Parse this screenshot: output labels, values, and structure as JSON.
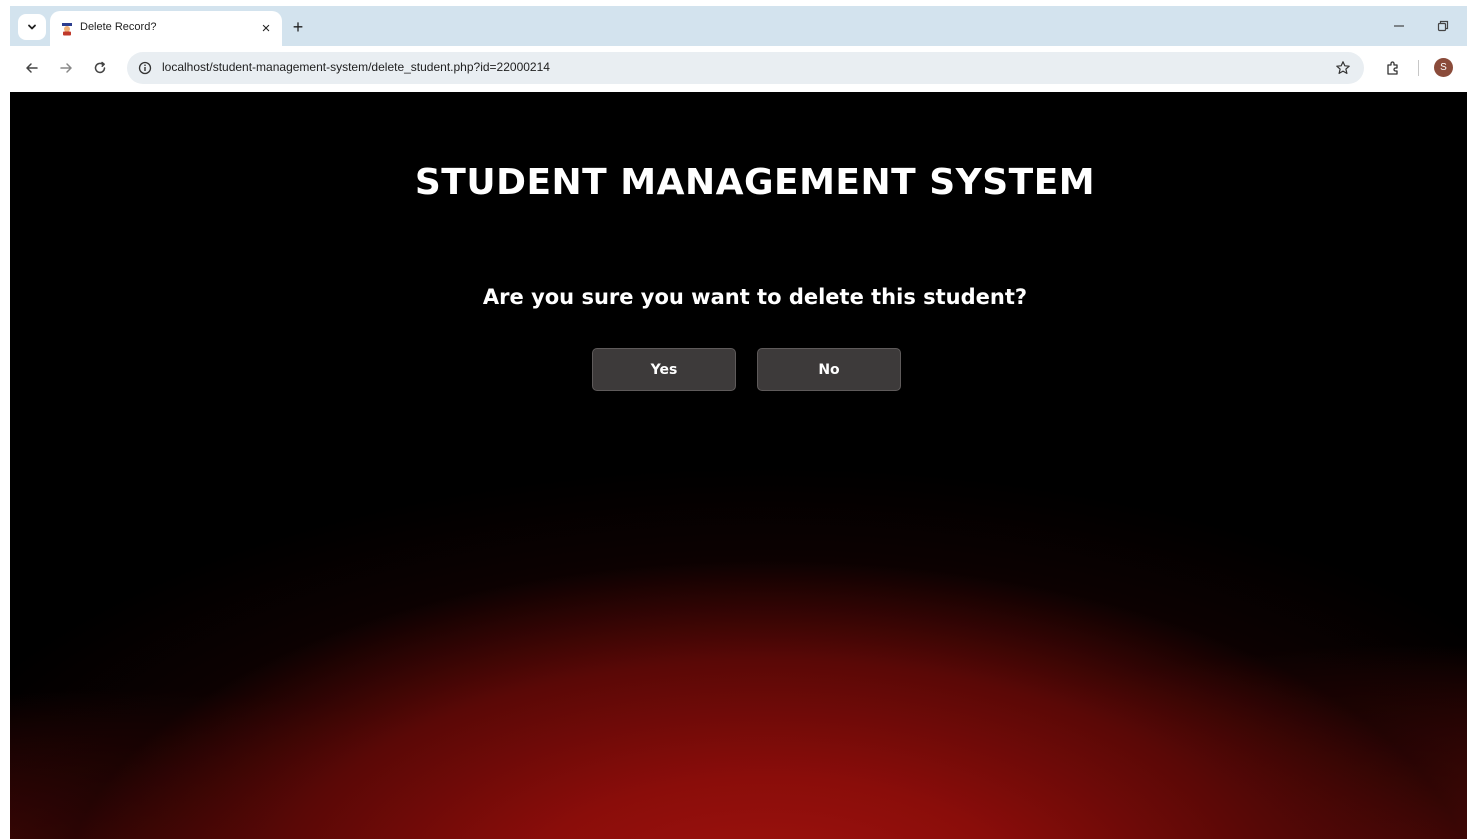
{
  "browser": {
    "tab": {
      "title": "Delete Record?",
      "close_glyph": "×"
    },
    "new_tab_glyph": "+",
    "address_bar": {
      "url": "localhost/student-management-system/delete_student.php?id=22000214"
    },
    "profile_initial": "S",
    "icons": {
      "tab_menu": "chevron-down-icon",
      "favicon": "graduate-icon",
      "back": "back-arrow-icon",
      "forward": "forward-arrow-icon",
      "reload": "reload-icon",
      "site_info": "info-icon",
      "bookmark": "star-icon",
      "extensions": "puzzle-icon",
      "minimize": "minimize-icon",
      "restore": "restore-icon"
    }
  },
  "page": {
    "title": "STUDENT MANAGEMENT SYSTEM",
    "confirm_message": "Are you sure you want to delete this student?",
    "yes_label": "Yes",
    "no_label": "No"
  },
  "colors": {
    "tabstrip_bg": "#d3e3ee",
    "page_bg": "#000000",
    "glow_red": "#a3130f",
    "button_bg": "#3d3a3a",
    "text": "#ffffff"
  }
}
